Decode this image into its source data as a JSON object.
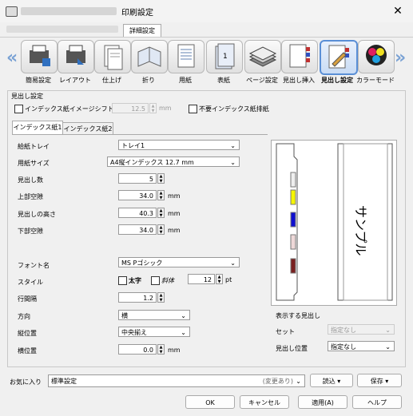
{
  "window": {
    "title": "印刷設定",
    "close_glyph": "✕"
  },
  "top_tab": {
    "label": "詳細設定"
  },
  "ribbon": {
    "left_arrow": "«",
    "right_arrow": "»",
    "items": [
      {
        "label": "簡易設定",
        "icon": "printer-settings-icon"
      },
      {
        "label": "レイアウト",
        "icon": "layout-icon"
      },
      {
        "label": "仕上げ",
        "icon": "finishing-icon"
      },
      {
        "label": "折り",
        "icon": "fold-icon"
      },
      {
        "label": "用紙",
        "icon": "paper-icon"
      },
      {
        "label": "表紙",
        "icon": "cover-icon",
        "badge": "1"
      },
      {
        "label": "ページ設定",
        "icon": "page-setting-icon"
      },
      {
        "label": "見出し挿入",
        "icon": "tab-insert-icon"
      },
      {
        "label": "見出し設定",
        "icon": "tab-setting-icon",
        "selected": true
      },
      {
        "label": "カラーモード",
        "icon": "color-mode-icon"
      }
    ]
  },
  "section": {
    "title": "見出し設定",
    "image_shift": {
      "label": "インデックス紙イメージシフト",
      "value": "12.5",
      "unit": "mm"
    },
    "remove_tabs": {
      "label": "不要インデックス紙排紙"
    },
    "tabs": [
      "インデックス紙1",
      "インデックス紙2"
    ],
    "rows": [
      {
        "label": "給紙トレイ",
        "value": "トレイ1"
      },
      {
        "label": "用紙サイズ",
        "value": "A4縦インデックス 12.7 mm"
      },
      {
        "label": "見出し数",
        "value": "5"
      },
      {
        "label": "上部空隙",
        "value": "34.0",
        "unit": "mm"
      },
      {
        "label": "見出しの高さ",
        "value": "40.3",
        "unit": "mm"
      },
      {
        "label": "下部空隙",
        "value": "34.0",
        "unit": "mm"
      }
    ],
    "font": {
      "label": "フォント名",
      "value": "MS Pゴシック"
    },
    "style": {
      "label": "スタイル",
      "bold": "太字",
      "italic": "斜体",
      "size": "12",
      "unit": "pt"
    },
    "line_spacing": {
      "label": "行間隔",
      "value": "1.2"
    },
    "direction": {
      "label": "方向",
      "value": "横"
    },
    "vertical": {
      "label": "縦位置",
      "value": "中央揃え"
    },
    "horizontal": {
      "label": "横位置",
      "value": "0.0",
      "unit": "mm"
    }
  },
  "preview": {
    "sample_text": "サンプル",
    "caption": "表示する見出し",
    "set": {
      "label": "セット",
      "value": "指定なし"
    },
    "position": {
      "label": "見出し位置",
      "value": "指定なし"
    },
    "tab_colors": [
      "#f5f500",
      "#1010d0",
      "#eed8d8",
      "#7a2020"
    ]
  },
  "favorites": {
    "label": "お気に入り",
    "value": "標準設定",
    "status": "(変更あり)",
    "load": "読込",
    "save": "保存"
  },
  "buttons": {
    "ok": "OK",
    "cancel": "キャンセル",
    "apply": "適用(A)",
    "help": "ヘルプ"
  }
}
